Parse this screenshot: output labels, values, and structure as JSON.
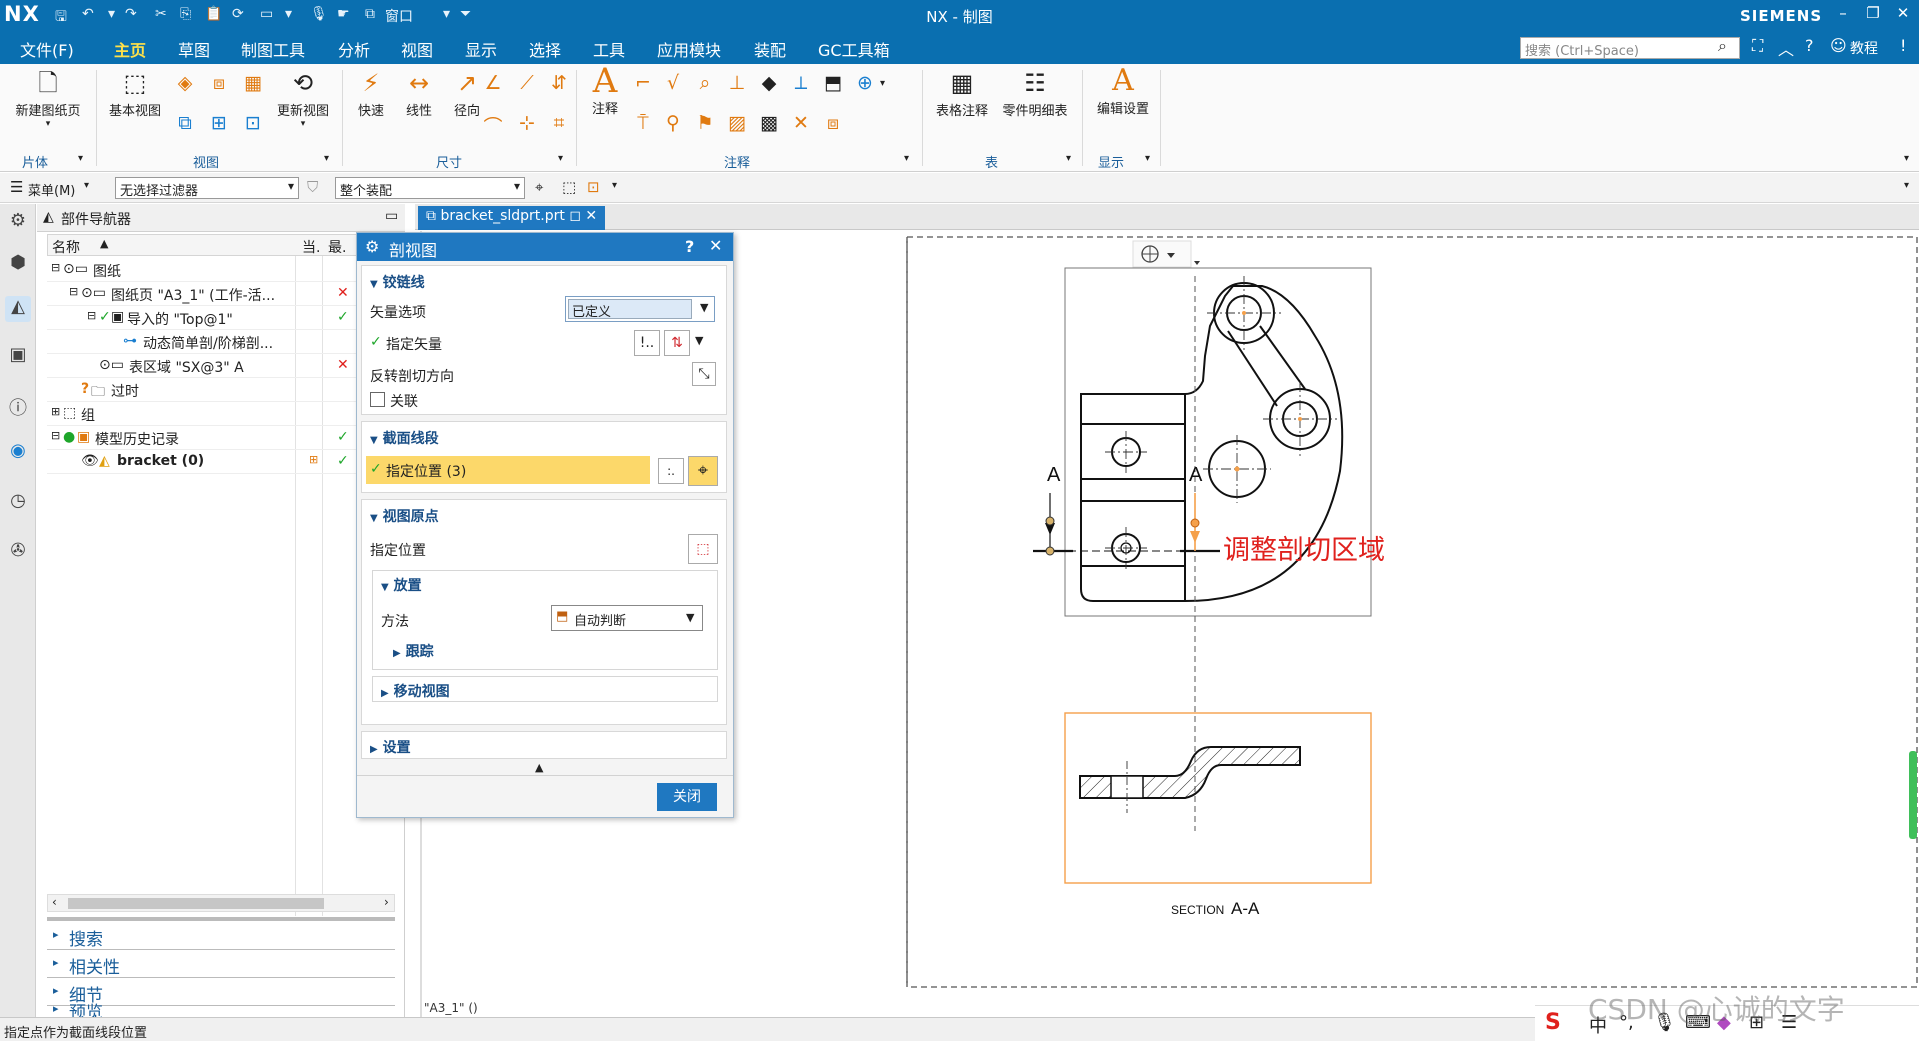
{
  "window": {
    "logo": "NX",
    "title": "NX - 制图",
    "brand": "SIEMENS",
    "quick_access": {
      "window_menu": "窗口"
    }
  },
  "menu": {
    "tabs": [
      "文件(F)",
      "主页",
      "草图",
      "制图工具",
      "分析",
      "视图",
      "显示",
      "选择",
      "工具",
      "应用模块",
      "装配",
      "GC工具箱"
    ],
    "active_tab": "主页",
    "search_placeholder": "搜索 (Ctrl+Space)",
    "tutorial": "教程"
  },
  "ribbon": {
    "new_sheet": "新建图纸页",
    "base_view": "基本视图",
    "update_view": "更新视图",
    "rapid": "快速",
    "linear": "线性",
    "radial": "径向",
    "annotation": "注释",
    "table_note": "表格注释",
    "parts_list": "零件明细表",
    "edit_settings": "编辑设置",
    "groups": {
      "sheet": "片体",
      "view": "视图",
      "dimension": "尺寸",
      "annotation": "注释",
      "table": "表",
      "display": "显示"
    }
  },
  "selbar": {
    "menu": "菜单(M)",
    "filter": "无选择过滤器",
    "scope": "整个装配"
  },
  "navigator": {
    "title": "部件导航器",
    "columns": {
      "name": "名称",
      "current": "当.",
      "latest": "最."
    },
    "rows": [
      {
        "label": "图纸",
        "status": ""
      },
      {
        "label": "图纸页 \"A3_1\" (工作-活...",
        "status": "x"
      },
      {
        "label": "导入的 \"Top@1\"",
        "status": "ok"
      },
      {
        "label": "动态简单剖/阶梯剖...",
        "status": ""
      },
      {
        "label": "表区域 \"SX@3\" A",
        "status": "x"
      },
      {
        "label": "过时",
        "status": ""
      },
      {
        "label": "组",
        "status": ""
      },
      {
        "label": "模型历史记录",
        "status": "ok"
      },
      {
        "label": "bracket (0)",
        "status": "ok"
      }
    ],
    "accordions": [
      "搜索",
      "相关性",
      "细节",
      "预览"
    ]
  },
  "dialog": {
    "title": "剖视图",
    "help": "?",
    "hinge_line": {
      "header": "铰链线",
      "vector_option_label": "矢量选项",
      "vector_option_value": "已定义",
      "specify_vector": "指定矢量",
      "reverse_direction": "反转剖切方向",
      "associative": "关联"
    },
    "section_segment": {
      "header": "截面线段",
      "specify_location": "指定位置 (3)"
    },
    "view_origin": {
      "header": "视图原点",
      "specify_location": "指定位置",
      "placement_header": "放置",
      "method_label": "方法",
      "method_value": "自动判断",
      "tracking": "跟踪",
      "move_view": "移动视图"
    },
    "settings": "设置",
    "close_button": "关闭"
  },
  "document": {
    "tab": "bracket_sldprt.prt",
    "section_label_a": "A",
    "section_label_a2": "A",
    "annotation": "调整剖切区域",
    "section_caption_small": "SECTION",
    "section_caption_big": "A-A",
    "sheet_name": "\"A3_1\"  ()"
  },
  "status": {
    "prompt": "指定点作为截面线段位置"
  },
  "watermark": "CSDN @心诚的文字",
  "ime": {
    "lang": "中"
  },
  "colors": {
    "titlebar": "#0a6fb0",
    "accent_yellow": "#ffe14a",
    "dialog_header": "#1f78c1",
    "highlight": "#fcd86a",
    "annotation_red": "#e0211d",
    "view_border_orange": "#f5a04a",
    "check_green": "#1ea62a"
  }
}
